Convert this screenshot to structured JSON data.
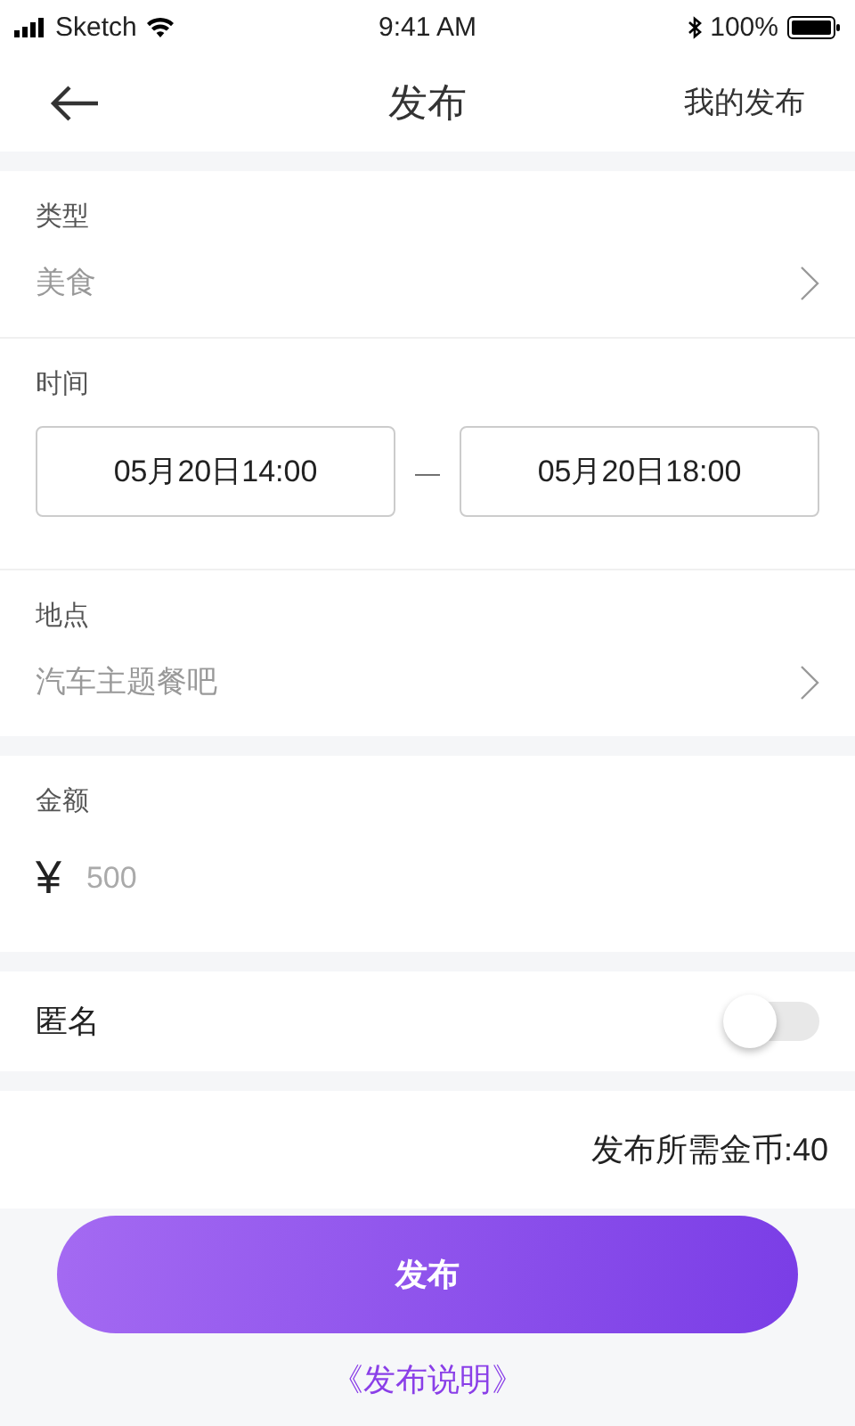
{
  "status_bar": {
    "carrier": "Sketch",
    "time": "9:41 AM",
    "battery": "100%"
  },
  "nav": {
    "title": "发布",
    "action": "我的发布"
  },
  "type": {
    "label": "类型",
    "value": "美食"
  },
  "time": {
    "label": "时间",
    "start": "05月20日14:00",
    "separator": "—",
    "end": "05月20日18:00"
  },
  "location": {
    "label": "地点",
    "value": "汽车主题餐吧"
  },
  "amount": {
    "label": "金额",
    "currency": "¥",
    "placeholder": "500"
  },
  "anonymous": {
    "label": "匿名",
    "on": false
  },
  "cost": "发布所需金币:40",
  "submit": "发布",
  "notice_link": "《发布说明》"
}
